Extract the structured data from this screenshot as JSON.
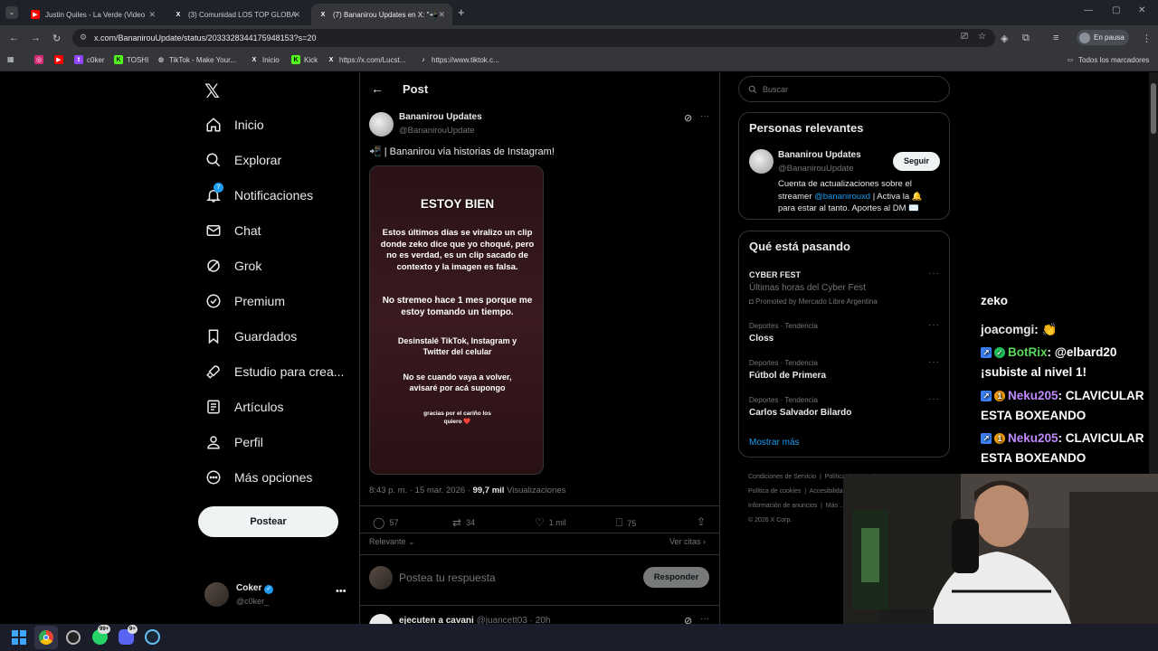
{
  "browser": {
    "tabs": [
      {
        "title": "Justin Quiles - La Verde (Video"
      },
      {
        "title": "(3) Comunidad LOS TOP GLOBA"
      },
      {
        "title": "(7) Bananirou Updates en X: \"📲"
      }
    ],
    "url": "x.com/BananirouUpdate/status/2033328344175948153?s=20",
    "profile_label": "En pausa",
    "bookmarks": [
      "c0ker",
      "TOSHI",
      "TikTok - Make Your...",
      "Inicio",
      "Kick",
      "https://x.com/Lucst...",
      "https://www.tiktok.c..."
    ],
    "all_bookmarks": "Todos los marcadores"
  },
  "sidebar": {
    "notification_count": "7",
    "items": [
      {
        "label": "Inicio",
        "icon": "home-icon"
      },
      {
        "label": "Explorar",
        "icon": "search-icon"
      },
      {
        "label": "Notificaciones",
        "icon": "bell-icon"
      },
      {
        "label": "Chat",
        "icon": "mail-icon"
      },
      {
        "label": "Grok",
        "icon": "grok-icon"
      },
      {
        "label": "Premium",
        "icon": "premium-icon"
      },
      {
        "label": "Guardados",
        "icon": "bookmark-icon"
      },
      {
        "label": "Estudio para crea...",
        "icon": "rocket-icon"
      },
      {
        "label": "Artículos",
        "icon": "article-icon"
      },
      {
        "label": "Perfil",
        "icon": "person-icon"
      },
      {
        "label": "Más opciones",
        "icon": "more-icon"
      }
    ],
    "post_button": "Postear",
    "account_name": "Coker",
    "account_handle": "@c0ker_"
  },
  "post": {
    "header": "Post",
    "author_name": "Bananirou Updates",
    "author_handle": "@BananirouUpdate",
    "text": "📲 | Bananirou vía historias de Instagram!",
    "story": {
      "title": "ESTOY BIEN",
      "p1": "Estos últimos días se viralizo un clip donde zeko dice que yo choqué, pero no es verdad, es un clip sacado de contexto y la imagen es falsa.",
      "p2": "No stremeo hace 1 mes porque me estoy tomando un tiempo.",
      "p3": "Desinstalé TikTok, Instagram y Twitter del celular",
      "p4": "No se cuando vaya a volver, avisaré por acá supongo",
      "p5": "gracias por el cariño los quiero ❤️"
    },
    "timestamp": "8:43 p. m. · 15 mar. 2026 ·",
    "views_count": "99,7 mil",
    "views_label": "Visualizaciones",
    "replies": "57",
    "reposts": "34",
    "likes": "1 mil",
    "bookmarks": "75",
    "sort_label": "Relevante",
    "quotes_label": "Ver citas",
    "reply_placeholder": "Postea tu respuesta",
    "reply_button": "Responder",
    "next_reply_name": "ejecuten a cavani",
    "next_reply_handle": "@juancett03 · 20h"
  },
  "right": {
    "search_placeholder": "Buscar",
    "relevant_title": "Personas relevantes",
    "person_name": "Bananirou Updates",
    "person_handle": "@BananirouUpdate",
    "follow_button": "Seguir",
    "bio_1": "Cuenta de actualizaciones sobre el",
    "bio_2a": "streamer",
    "bio_mention": "@bananirouxd",
    "bio_2b": "| Activa la 🔔",
    "bio_3": "para estar al tanto. Aportes al DM ✉️",
    "trending_title": "Qué está pasando",
    "trends": [
      {
        "context": "CYBER FEST",
        "name": "Últimas horas del Cyber Fest",
        "promoted": "Promoted by Mercado Libre Argentina"
      },
      {
        "context": "Deportes · Tendencia",
        "name": "Closs"
      },
      {
        "context": "Deportes · Tendencia",
        "name": "Fútbol de Primera"
      },
      {
        "context": "Deportes · Tendencia",
        "name": "Carlos Salvador Bilardo"
      }
    ],
    "show_more": "Mostrar más",
    "footer": [
      "Condiciones de Servicio",
      "Política de Privacidad",
      "Política de cookies",
      "Accesibilidad",
      "Información de anuncios",
      "Más ...",
      "© 2026 X Corp."
    ]
  },
  "chat": {
    "partial": "zeko",
    "messages": [
      {
        "user": "joacomgi",
        "user_color": "#e8e8e8",
        "text": ": 👏"
      },
      {
        "user": "BotRix",
        "user_color": "#5bd75b",
        "text": ": @elbard20",
        "text2": "¡subiste al nivel 1!"
      },
      {
        "user": "Neku205",
        "user_color": "#c08aff",
        "text": ": CLAVICULAR",
        "text2": "ESTA BOXEANDO"
      },
      {
        "user": "Neku205",
        "user_color": "#c08aff",
        "text": ": CLAVICULAR",
        "text2": "ESTA BOXEANDO"
      }
    ]
  },
  "taskbar": {
    "whatsapp_badge": "99+",
    "discord_badge": "9+"
  },
  "colors": {
    "accent": "#1d9bf0",
    "background": "#000000",
    "border": "#2f3336"
  }
}
